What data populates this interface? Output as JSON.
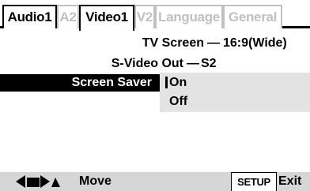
{
  "tabs": [
    {
      "label": "Audio1",
      "state": "normal"
    },
    {
      "label": "A2",
      "state": "disabled"
    },
    {
      "label": "Video1",
      "state": "active"
    },
    {
      "label": "V2",
      "state": "disabled"
    },
    {
      "label": "Language",
      "state": "disabled"
    },
    {
      "label": "General",
      "state": "disabled"
    }
  ],
  "settings": [
    {
      "label": "TV Screen",
      "separator": "—",
      "value": "16:9(Wide)"
    },
    {
      "label": "S-Video Out",
      "separator": "—",
      "value": "S2"
    },
    {
      "label": "Screen Saver",
      "selected": true
    }
  ],
  "dropdown": {
    "options": [
      "On",
      "Off"
    ],
    "highlighted": "On"
  },
  "bottom": {
    "nav_icon": "arrow-keys-icon",
    "move_label": "Move",
    "setup_label": "SETUP",
    "exit_label": "Exit"
  },
  "colors": {
    "highlight_bg": "#000000",
    "dropdown_bg": "#e3e3e3",
    "bottom_bar_bg": "#d6d6d6",
    "disabled_text": "#c0c0c0"
  }
}
